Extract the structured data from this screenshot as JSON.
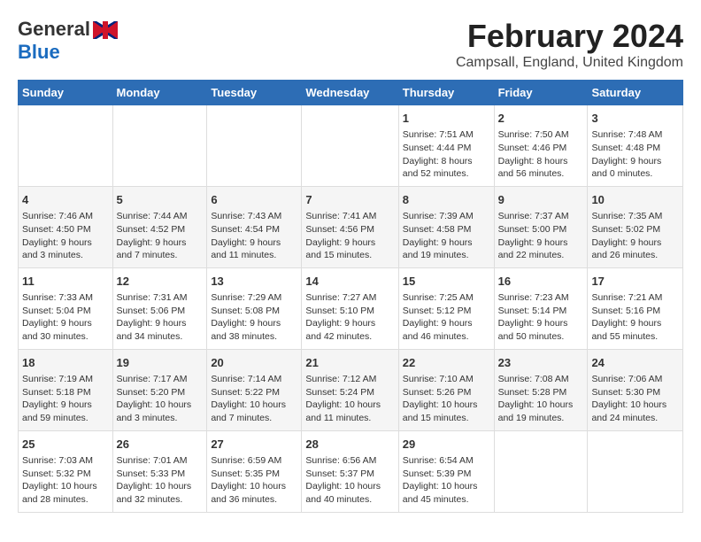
{
  "logo": {
    "general": "General",
    "blue": "Blue"
  },
  "title": "February 2024",
  "subtitle": "Campsall, England, United Kingdom",
  "days_header": [
    "Sunday",
    "Monday",
    "Tuesday",
    "Wednesday",
    "Thursday",
    "Friday",
    "Saturday"
  ],
  "weeks": [
    [
      {
        "num": "",
        "info": ""
      },
      {
        "num": "",
        "info": ""
      },
      {
        "num": "",
        "info": ""
      },
      {
        "num": "",
        "info": ""
      },
      {
        "num": "1",
        "info": "Sunrise: 7:51 AM\nSunset: 4:44 PM\nDaylight: 8 hours\nand 52 minutes."
      },
      {
        "num": "2",
        "info": "Sunrise: 7:50 AM\nSunset: 4:46 PM\nDaylight: 8 hours\nand 56 minutes."
      },
      {
        "num": "3",
        "info": "Sunrise: 7:48 AM\nSunset: 4:48 PM\nDaylight: 9 hours\nand 0 minutes."
      }
    ],
    [
      {
        "num": "4",
        "info": "Sunrise: 7:46 AM\nSunset: 4:50 PM\nDaylight: 9 hours\nand 3 minutes."
      },
      {
        "num": "5",
        "info": "Sunrise: 7:44 AM\nSunset: 4:52 PM\nDaylight: 9 hours\nand 7 minutes."
      },
      {
        "num": "6",
        "info": "Sunrise: 7:43 AM\nSunset: 4:54 PM\nDaylight: 9 hours\nand 11 minutes."
      },
      {
        "num": "7",
        "info": "Sunrise: 7:41 AM\nSunset: 4:56 PM\nDaylight: 9 hours\nand 15 minutes."
      },
      {
        "num": "8",
        "info": "Sunrise: 7:39 AM\nSunset: 4:58 PM\nDaylight: 9 hours\nand 19 minutes."
      },
      {
        "num": "9",
        "info": "Sunrise: 7:37 AM\nSunset: 5:00 PM\nDaylight: 9 hours\nand 22 minutes."
      },
      {
        "num": "10",
        "info": "Sunrise: 7:35 AM\nSunset: 5:02 PM\nDaylight: 9 hours\nand 26 minutes."
      }
    ],
    [
      {
        "num": "11",
        "info": "Sunrise: 7:33 AM\nSunset: 5:04 PM\nDaylight: 9 hours\nand 30 minutes."
      },
      {
        "num": "12",
        "info": "Sunrise: 7:31 AM\nSunset: 5:06 PM\nDaylight: 9 hours\nand 34 minutes."
      },
      {
        "num": "13",
        "info": "Sunrise: 7:29 AM\nSunset: 5:08 PM\nDaylight: 9 hours\nand 38 minutes."
      },
      {
        "num": "14",
        "info": "Sunrise: 7:27 AM\nSunset: 5:10 PM\nDaylight: 9 hours\nand 42 minutes."
      },
      {
        "num": "15",
        "info": "Sunrise: 7:25 AM\nSunset: 5:12 PM\nDaylight: 9 hours\nand 46 minutes."
      },
      {
        "num": "16",
        "info": "Sunrise: 7:23 AM\nSunset: 5:14 PM\nDaylight: 9 hours\nand 50 minutes."
      },
      {
        "num": "17",
        "info": "Sunrise: 7:21 AM\nSunset: 5:16 PM\nDaylight: 9 hours\nand 55 minutes."
      }
    ],
    [
      {
        "num": "18",
        "info": "Sunrise: 7:19 AM\nSunset: 5:18 PM\nDaylight: 9 hours\nand 59 minutes."
      },
      {
        "num": "19",
        "info": "Sunrise: 7:17 AM\nSunset: 5:20 PM\nDaylight: 10 hours\nand 3 minutes."
      },
      {
        "num": "20",
        "info": "Sunrise: 7:14 AM\nSunset: 5:22 PM\nDaylight: 10 hours\nand 7 minutes."
      },
      {
        "num": "21",
        "info": "Sunrise: 7:12 AM\nSunset: 5:24 PM\nDaylight: 10 hours\nand 11 minutes."
      },
      {
        "num": "22",
        "info": "Sunrise: 7:10 AM\nSunset: 5:26 PM\nDaylight: 10 hours\nand 15 minutes."
      },
      {
        "num": "23",
        "info": "Sunrise: 7:08 AM\nSunset: 5:28 PM\nDaylight: 10 hours\nand 19 minutes."
      },
      {
        "num": "24",
        "info": "Sunrise: 7:06 AM\nSunset: 5:30 PM\nDaylight: 10 hours\nand 24 minutes."
      }
    ],
    [
      {
        "num": "25",
        "info": "Sunrise: 7:03 AM\nSunset: 5:32 PM\nDaylight: 10 hours\nand 28 minutes."
      },
      {
        "num": "26",
        "info": "Sunrise: 7:01 AM\nSunset: 5:33 PM\nDaylight: 10 hours\nand 32 minutes."
      },
      {
        "num": "27",
        "info": "Sunrise: 6:59 AM\nSunset: 5:35 PM\nDaylight: 10 hours\nand 36 minutes."
      },
      {
        "num": "28",
        "info": "Sunrise: 6:56 AM\nSunset: 5:37 PM\nDaylight: 10 hours\nand 40 minutes."
      },
      {
        "num": "29",
        "info": "Sunrise: 6:54 AM\nSunset: 5:39 PM\nDaylight: 10 hours\nand 45 minutes."
      },
      {
        "num": "",
        "info": ""
      },
      {
        "num": "",
        "info": ""
      }
    ]
  ]
}
